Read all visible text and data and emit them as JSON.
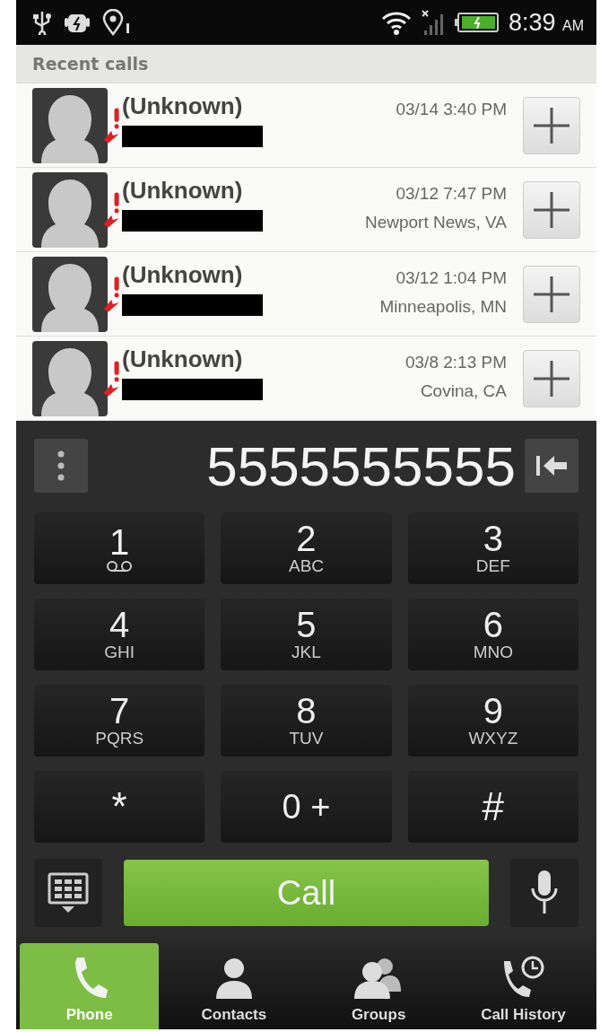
{
  "status_bar": {
    "time": "8:39",
    "meridiem": "AM"
  },
  "recent_calls": {
    "title": "Recent calls",
    "rows": [
      {
        "name": "(Unknown)",
        "time": "03/14 3:40 PM",
        "number_redacted": true
      },
      {
        "name": "(Unknown)",
        "time": "03/12 7:47 PM",
        "location": "Newport News, VA",
        "number_redacted": true
      },
      {
        "name": "(Unknown)",
        "time": "03/12 1:04 PM",
        "location": "Minneapolis, MN",
        "number_redacted": true
      },
      {
        "name": "(Unknown)",
        "time": "03/8 2:13 PM",
        "location": "Covina, CA",
        "number_redacted": true
      }
    ]
  },
  "dialer": {
    "number": "5555555555",
    "keys": [
      {
        "digit": "1",
        "kind": "voicemail"
      },
      {
        "digit": "2",
        "letters": "ABC",
        "kind": "letters"
      },
      {
        "digit": "3",
        "letters": "DEF",
        "kind": "letters"
      },
      {
        "digit": "4",
        "letters": "GHI",
        "kind": "letters"
      },
      {
        "digit": "5",
        "letters": "JKL",
        "kind": "letters"
      },
      {
        "digit": "6",
        "letters": "MNO",
        "kind": "letters"
      },
      {
        "digit": "7",
        "letters": "PQRS",
        "kind": "letters"
      },
      {
        "digit": "8",
        "letters": "TUV",
        "kind": "letters"
      },
      {
        "digit": "9",
        "letters": "WXYZ",
        "kind": "letters"
      },
      {
        "digit": "*",
        "kind": "symbol"
      },
      {
        "digit": "0",
        "letters": "+",
        "kind": "inline"
      },
      {
        "digit": "#",
        "kind": "symbol"
      }
    ],
    "call_button": "Call"
  },
  "tabs": [
    {
      "label": "Phone",
      "kind": "phone",
      "selected": true
    },
    {
      "label": "Contacts",
      "kind": "person",
      "selected": false
    },
    {
      "label": "Groups",
      "kind": "people",
      "selected": false
    },
    {
      "label": "Call History",
      "kind": "history",
      "selected": false
    }
  ]
}
